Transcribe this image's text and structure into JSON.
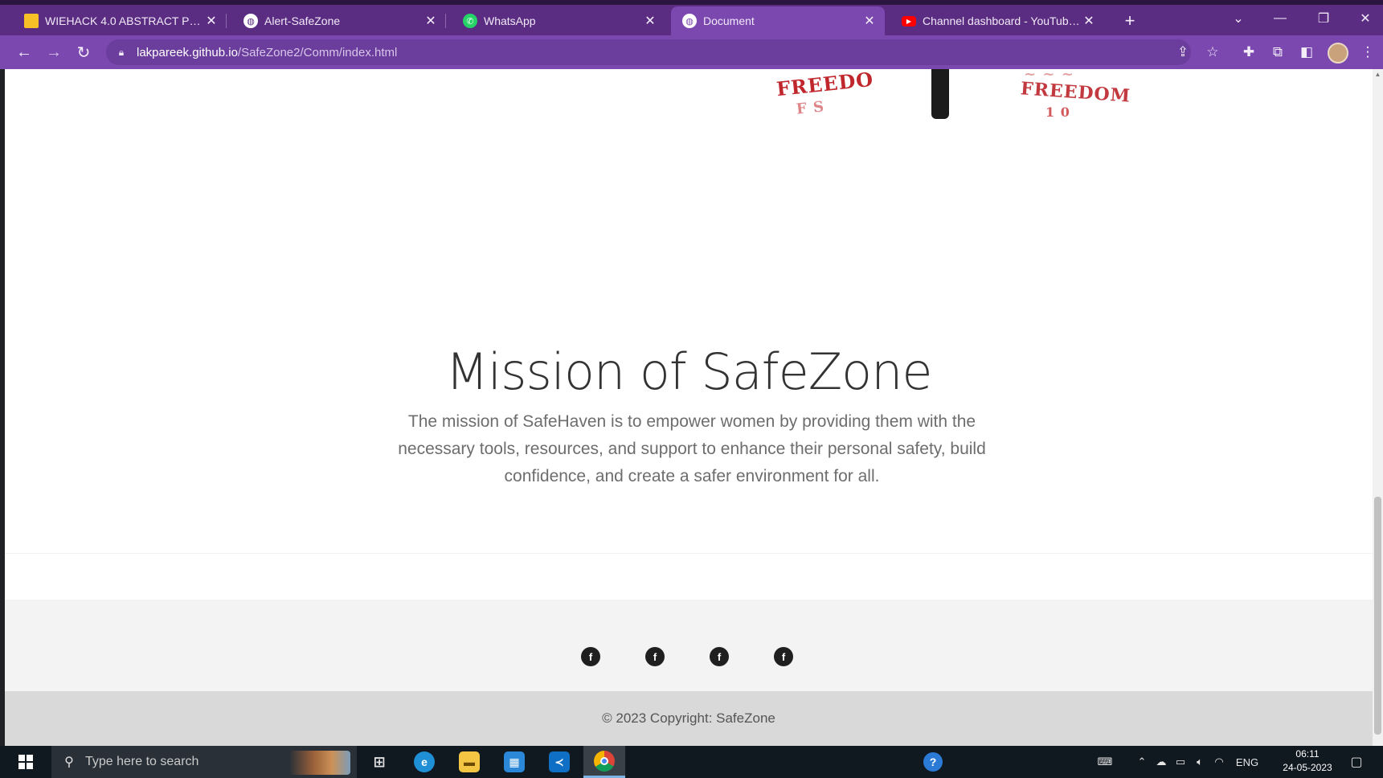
{
  "tabs": [
    {
      "title": "WIEHACK 4.0 ABSTRACT PPT - G",
      "favicon": "slides-icon"
    },
    {
      "title": "Alert-SafeZone",
      "favicon": "globe-icon"
    },
    {
      "title": "WhatsApp",
      "favicon": "whatsapp-icon"
    },
    {
      "title": "Document",
      "favicon": "globe-icon",
      "active": true
    },
    {
      "title": "Channel dashboard - YouTube S",
      "favicon": "youtube-icon"
    }
  ],
  "address": {
    "host": "lakpareek.github.io",
    "path": "/SafeZone2/Comm/index.html"
  },
  "hero": {
    "word_left": "FREEDO",
    "word_right": "FREEDOM"
  },
  "mission": {
    "title": "Mission of SafeZone",
    "text": "The mission of SafeHaven is to empower women by providing them with the necessary tools, resources, and support to enhance their personal safety, build confidence, and create a safer environment for all."
  },
  "footer": {
    "social": [
      {
        "label": "f",
        "icon": "facebook-icon"
      },
      {
        "label": "f",
        "icon": "facebook-icon"
      },
      {
        "label": "f",
        "icon": "facebook-icon"
      },
      {
        "label": "f",
        "icon": "facebook-icon"
      }
    ],
    "copyright": "© 2023 Copyright: SafeZone"
  },
  "taskbar": {
    "search_placeholder": "Type here to search",
    "language": "ENG",
    "time": "06:11",
    "date": "24-05-2023"
  },
  "colors": {
    "tabstrip": "#5a2d82",
    "toolbar": "#7b48b0",
    "accent_red": "#c0272d"
  }
}
